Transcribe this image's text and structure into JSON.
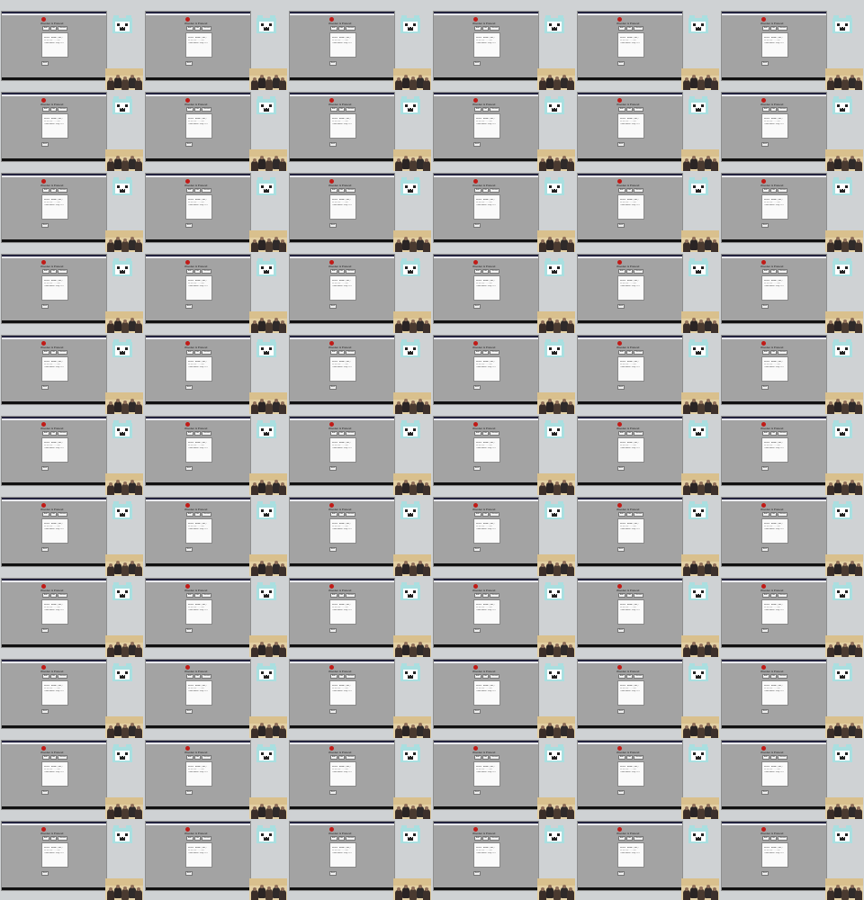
{
  "grid": {
    "columns": 6,
    "rows": 11
  },
  "tile": {
    "app_title": "Wooden & Pretend",
    "buttons": [
      "Add",
      "Edit",
      "Remove"
    ],
    "dialog_lines": [
      "Item A · \"ABBA\" ( box )",
      "##·## ### · · · · ###",
      "Three bound · Fifty ####"
    ],
    "back_label": "Back",
    "mascot": "bear-face-icon",
    "photo": "group-photo"
  },
  "colors": {
    "background": "#cfd2d4",
    "window": "#a3a3a3",
    "titlebar": "#23233f",
    "logo": "#c11b17",
    "mascot": "#a9dfe0"
  }
}
